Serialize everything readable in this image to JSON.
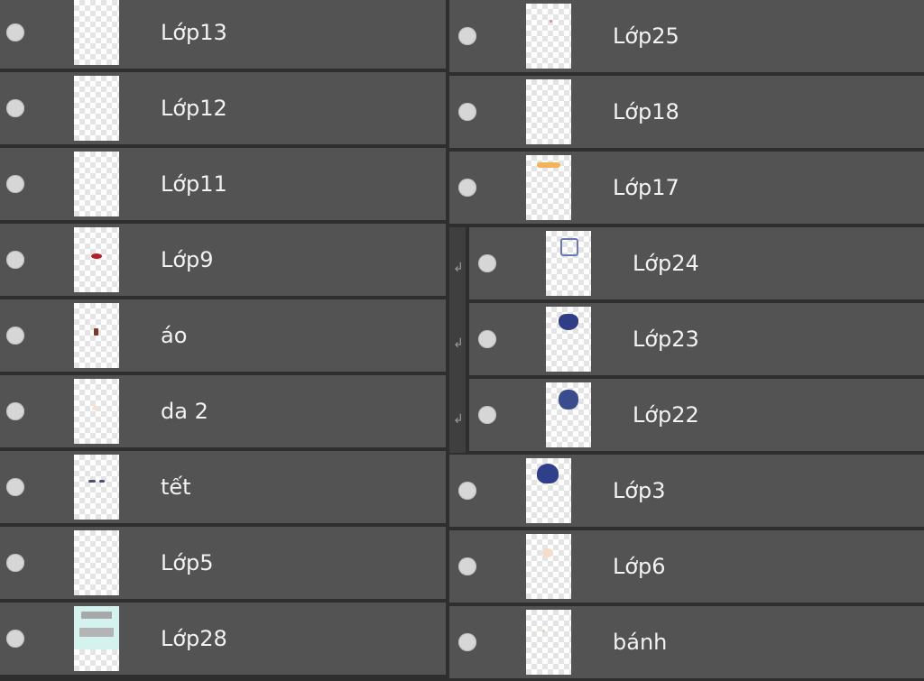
{
  "panels": {
    "left": {
      "layers": [
        {
          "name": "Lớp13",
          "thumb": "empty"
        },
        {
          "name": "Lớp12",
          "thumb": "empty"
        },
        {
          "name": "Lớp11",
          "thumb": "empty"
        },
        {
          "name": "Lớp9",
          "thumb": "red-dots"
        },
        {
          "name": "áo",
          "thumb": "brown-triangle"
        },
        {
          "name": "da 2",
          "thumb": "faint-skin"
        },
        {
          "name": "tết",
          "thumb": "navy-strokes"
        },
        {
          "name": "Lớp5",
          "thumb": "empty"
        },
        {
          "name": "Lớp28",
          "thumb": "teal-gray-box"
        }
      ]
    },
    "right": {
      "layers": [
        {
          "name": "Lớp25",
          "thumb": "pink-dot",
          "clipped": false
        },
        {
          "name": "Lớp18",
          "thumb": "empty",
          "clipped": false
        },
        {
          "name": "Lớp17",
          "thumb": "orange-stroke",
          "clipped": false
        },
        {
          "name": "Lớp24",
          "thumb": "blue-outline",
          "clipped": true
        },
        {
          "name": "Lớp23",
          "thumb": "navy-shape",
          "clipped": true
        },
        {
          "name": "Lớp22",
          "thumb": "navy-blob",
          "clipped": true
        },
        {
          "name": "Lớp3",
          "thumb": "navy-hair",
          "clipped": false
        },
        {
          "name": "Lớp6",
          "thumb": "peach-blob",
          "clipped": false
        },
        {
          "name": "bánh",
          "thumb": "tiny-dot",
          "clipped": false
        }
      ]
    }
  },
  "icons": {
    "visibility": "visibility-dot-icon",
    "clipping": "clipping-arrow-icon"
  },
  "colors": {
    "row_bg": "#535353",
    "separator": "#2e2e2e",
    "text": "#f2f2f2",
    "eye": "#d6d6d6"
  }
}
